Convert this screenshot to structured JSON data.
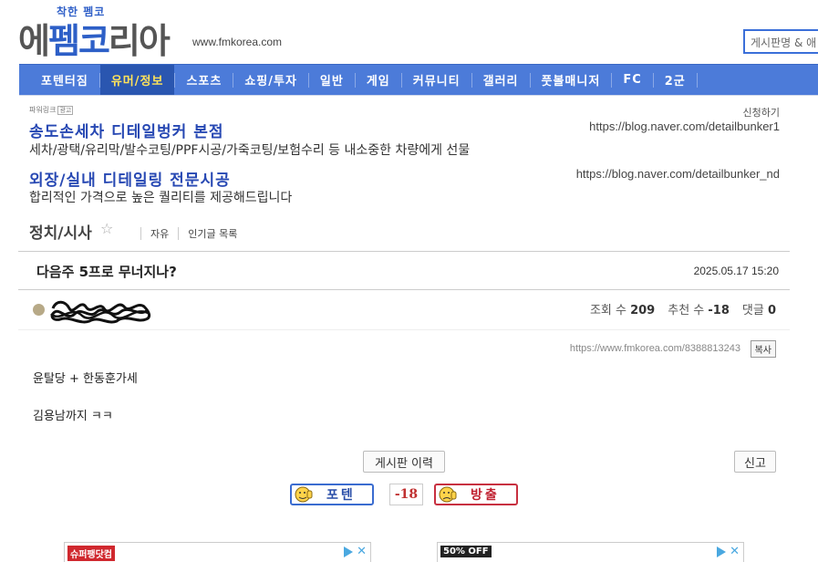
{
  "header": {
    "tagline": "착한 펨코",
    "brand_parts": [
      "에",
      "펨",
      "코",
      "리아"
    ],
    "site_url": "www.fmkorea.com",
    "search_placeholder": "게시판명 & 애"
  },
  "nav": {
    "items": [
      "포텐터짐",
      "유머/정보",
      "스포츠",
      "쇼핑/투자",
      "일반",
      "게임",
      "커뮤니티",
      "갤러리",
      "풋볼매니저",
      "FC",
      "2군"
    ],
    "active_index": 1,
    "active_color": "#ffe35a",
    "bar_color": "#4c7bd9"
  },
  "ads": {
    "label": "파워링크",
    "badge": "광고",
    "apply": "신청하기",
    "items": [
      {
        "title": "송도손세차 디테일벙커 본점",
        "desc": "세차/광택/유리막/발수코팅/PPF시공/가죽코팅/보험수리 등 내소중한 차량에게 선물",
        "url": "https://blog.naver.com/detailbunker1"
      },
      {
        "title": "외장/실내 디테일링 전문시공",
        "desc": "합리적인 가격으로 높은 퀄리티를 제공해드립니다",
        "url": "https://blog.naver.com/detailbunker_nd"
      }
    ]
  },
  "board": {
    "title": "정치/시사",
    "star_icon": "star-outline-icon",
    "links": [
      "자유",
      "인기글 목록"
    ]
  },
  "post": {
    "title": "다음주 5프로 무너지나?",
    "date": "2025.05.17 15:20",
    "stats": {
      "views_label": "조회 수",
      "views": "209",
      "votes_label": "추천 수",
      "votes": "-18",
      "comments_label": "댓글",
      "comments": "0"
    },
    "url": "https://www.fmkorea.com/8388813243",
    "copy_label": "복사",
    "body": [
      "윤탈당 + 한동훈가세",
      "김용남까지 ㅋㅋ"
    ],
    "history_label": "게시판 이력",
    "report_label": "신고"
  },
  "vote": {
    "up_label": "포텐",
    "count": "-18",
    "down_label": "방출"
  },
  "banners": {
    "left_tag": "슈퍼팽닷컴",
    "right_tag": "50% OFF"
  }
}
